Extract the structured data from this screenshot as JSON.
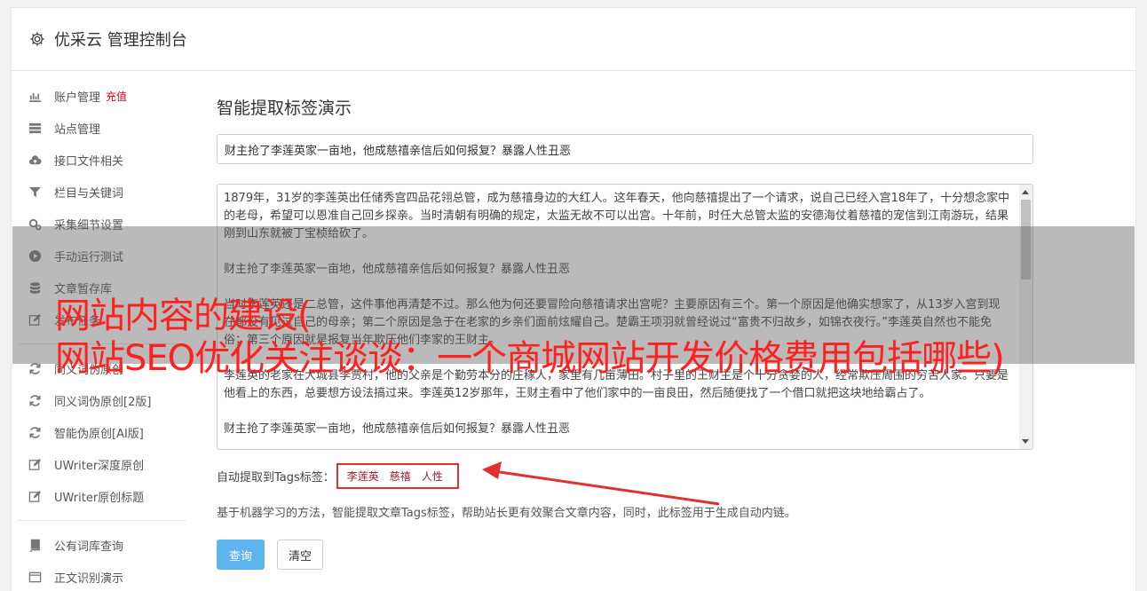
{
  "header": {
    "title": "优采云 管理控制台"
  },
  "sidebar": {
    "items": [
      {
        "label": "账户管理",
        "badge": "充值",
        "icon": "bar-chart-icon"
      },
      {
        "label": "站点管理",
        "icon": "server-icon"
      },
      {
        "label": "接口文件相关",
        "icon": "cloud-upload-icon"
      },
      {
        "label": "栏目与关键词",
        "icon": "filter-icon"
      },
      {
        "label": "采集细节设置",
        "icon": "gears-icon"
      },
      {
        "label": "手动运行测试",
        "icon": "play-circle-icon"
      },
      {
        "label": "文章暂存库",
        "icon": "database-icon"
      },
      {
        "label": "发布任务",
        "icon": "edit-icon"
      }
    ],
    "items2": [
      {
        "label": "同义词伪原创",
        "icon": "refresh-icon"
      },
      {
        "label": "同义词伪原创[2版]",
        "icon": "refresh-icon"
      },
      {
        "label": "智能伪原创[AI版]",
        "icon": "refresh-icon"
      },
      {
        "label": "UWriter深度原创",
        "icon": "edit-icon"
      },
      {
        "label": "UWriter原创标题",
        "icon": "edit-icon"
      }
    ],
    "items3": [
      {
        "label": "公有词库查询",
        "icon": "book-icon"
      },
      {
        "label": "正文识别演示",
        "icon": "window-icon"
      }
    ]
  },
  "main": {
    "heading": "智能提取标签演示",
    "title_value": "财主抢了李莲英家一亩地，他成慈禧亲信后如何报复？暴露人性丑恶",
    "content_paragraphs": [
      "1879年，31岁的李莲英出任储秀宫四品花翎总管，成为慈禧身边的大红人。这年春天，他向慈禧提出了一个请求，说自己已经入宫18年了，十分想念家中的老母，希望可以恩准自己回乡探亲。当时清朝有明确的规定，太监无故不可以出宫。十年前，时任大总管太监的安德海仗着慈禧的宠信到江南游玩，结果刚到山东就被丁宝桢给砍了。",
      "财主抢了李莲英家一亩地，他成慈禧亲信后如何报复？暴露人性丑恶",
      "当时李莲英还是二总管，这件事他再清楚不过。那么他为何还要冒险向慈禧请求出宫呢？主要原因有三个。第一个原因是他确实想家了，从13岁入宫到现在都没有见过自己的母亲；第二个原因是急于在老家的乡亲们面前炫耀自己。楚霸王项羽就曾经说过“富贵不归故乡，如锦衣夜行。”李莲英自然也不能免俗；第三个原因就是报复当年欺压他们李家的王财主。",
      "李莲英的老家在大城县李贾村，他的父亲是个勤劳本分的庄稼人，家里有几亩薄田。村子里的王财主是个十分贪婪的人，经常欺压周围的穷苦人家。只要是他看上的东西，总要想方设法搞过来。李莲英12岁那年，王财主看中了他们家中的一亩良田，然后随便找了一个借口就把这块地给霸占了。",
      "财主抢了李莲英家一亩地，他成慈禧亲信后如何报复？暴露人性丑恶"
    ],
    "tags_label": "自动提取到Tags标签：",
    "tags": [
      "李莲英",
      "慈禧",
      "人性"
    ],
    "description": "基于机器学习的方法，智能提取文章Tags标签，帮助站长更有效聚合文章内容，同时，此标签用于生成自动内链。",
    "query_button": "查询",
    "clear_button": "清空"
  },
  "overlay": {
    "line1": "网站内容的建设(",
    "line2": "网站SEO优化关注谈谈：一个商城网站开发价格费用包括哪些)"
  },
  "colors": {
    "accent": "#5eb4ef",
    "recharge": "#d9001b",
    "tag": "#9b1c2e",
    "annotation": "#e03030",
    "overlay_text": "#ff2020"
  }
}
